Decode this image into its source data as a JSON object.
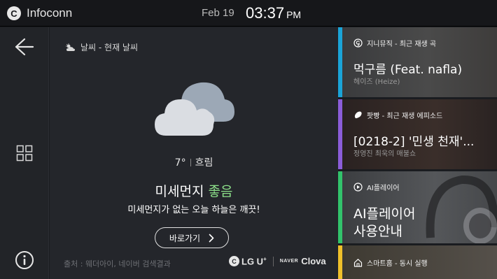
{
  "topbar": {
    "brand_logo": "C",
    "brand_name": "Infoconn",
    "date": "Feb 19",
    "time": "03:37",
    "ampm": "PM"
  },
  "rail": {
    "icons": [
      "back-arrow-icon",
      "grid-icon",
      "info-icon"
    ]
  },
  "weather": {
    "header": "날씨 - 현재 날씨",
    "header_icon": "partly-cloudy-icon",
    "condition_icon": "cloud-icon",
    "temperature": "7°",
    "condition": "흐림",
    "dust_label": "미세먼지",
    "dust_status": "좋음",
    "dust_description": "미세먼지가 없는 오늘 하늘은 깨끗!",
    "goto_label": "바로가기",
    "source": "출처 : 웨더아이, 네이버 검색결과",
    "partner_lg_logo": "C",
    "partner_lg": "LG U",
    "partner_lg_plus": "+",
    "partner_naver": "NAVER",
    "partner_clova": "Clova"
  },
  "cards": [
    {
      "label": "지니뮤직 - 최근 재생 곡",
      "icon": "genie-music-icon",
      "title": "먹구름 (Feat. nafla)",
      "subtitle": "헤이즈 (Heize)",
      "accent": "#1aa4d8"
    },
    {
      "label": "팟빵 - 최근 재생 에피소드",
      "icon": "podbbang-icon",
      "title": "[0218-2] '민생 천재'...",
      "subtitle": "정영진 최욱의 매불쇼",
      "accent": "#8b5dd9"
    },
    {
      "label": "AI플레이어",
      "icon": "ai-player-icon",
      "title": "AI플레이어",
      "title2": "사용안내",
      "accent": "#32c36b"
    },
    {
      "label": "스마트홈 - 동시 실행",
      "icon": "smart-home-icon",
      "accent": "#f0c02a"
    }
  ],
  "colors": {
    "dust_good": "#8de08a",
    "background": "#1a1c20",
    "panel": "#24262b"
  }
}
